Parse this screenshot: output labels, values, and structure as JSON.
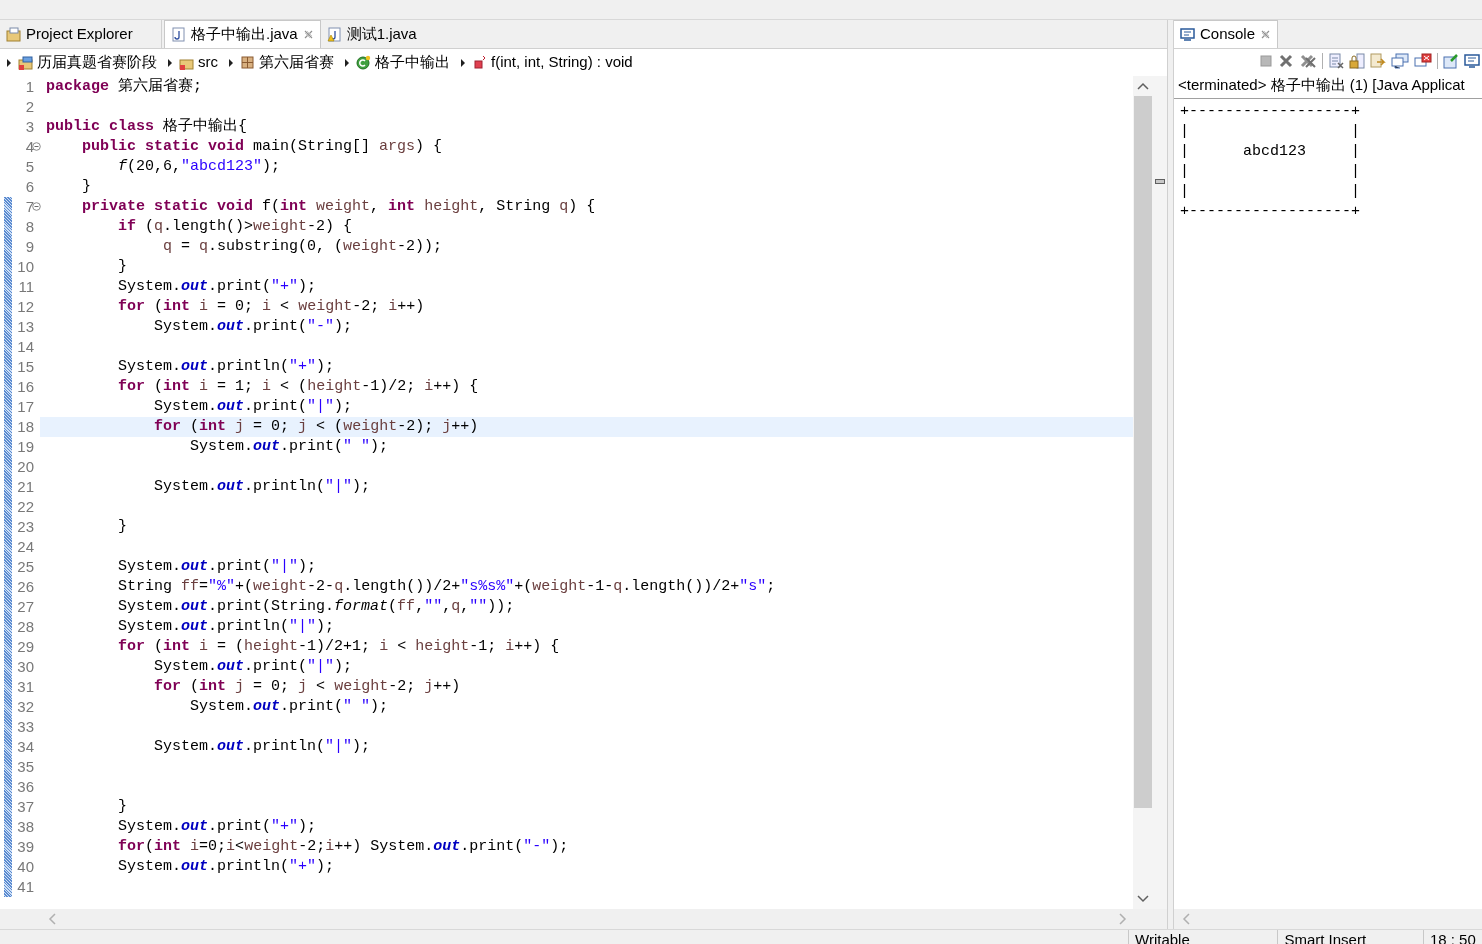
{
  "tabs": [
    {
      "label": "Project Explorer",
      "kind": "view",
      "selected": false,
      "closable": false
    },
    {
      "label": "格子中输出.java",
      "kind": "java",
      "selected": true,
      "closable": true
    },
    {
      "label": "测试1.java",
      "kind": "java-warning",
      "selected": false,
      "closable": false
    }
  ],
  "breadcrumb": [
    {
      "label": "历届真题省赛阶段",
      "kind": "project"
    },
    {
      "label": "src",
      "kind": "source"
    },
    {
      "label": "第六届省赛",
      "kind": "package"
    },
    {
      "label": "格子中输出",
      "kind": "class"
    },
    {
      "label": "f(int, int, String) : void",
      "kind": "method"
    }
  ],
  "editor": {
    "lines": [
      {
        "number": "1",
        "tokens": [
          {
            "kind": "kw",
            "text": "package"
          },
          {
            "kind": "plain",
            "text": " 第六届省赛;"
          }
        ]
      },
      {
        "number": "2"
      },
      {
        "number": "3",
        "tokens": [
          {
            "kind": "kw",
            "text": "public class"
          },
          {
            "kind": "plain",
            "text": " 格子中输出{"
          }
        ]
      },
      {
        "number": "4",
        "fold_marker": true,
        "tokens": [
          {
            "kind": "kw",
            "text": "    public static void"
          },
          {
            "kind": "plain",
            "text": " main(String[] "
          },
          {
            "kind": "var",
            "text": "args"
          },
          {
            "kind": "plain",
            "text": ") {"
          }
        ]
      },
      {
        "number": "5",
        "tokens": [
          {
            "kind": "static",
            "text": "        f"
          },
          {
            "kind": "plain",
            "text": "(20,6,"
          },
          {
            "kind": "str",
            "text": "\"abcd123\""
          },
          {
            "kind": "plain",
            "text": ");"
          }
        ]
      },
      {
        "number": "6",
        "tokens": [
          {
            "kind": "plain",
            "text": "    }"
          }
        ]
      },
      {
        "number": "7",
        "fold_marker": true,
        "changed": true,
        "tokens": [
          {
            "kind": "kw",
            "text": "    private static void"
          },
          {
            "kind": "plain",
            "text": " f("
          },
          {
            "kind": "kw",
            "text": "int "
          },
          {
            "kind": "var",
            "text": "weight"
          },
          {
            "kind": "plain",
            "text": ", "
          },
          {
            "kind": "kw",
            "text": "int "
          },
          {
            "kind": "var",
            "text": "height"
          },
          {
            "kind": "plain",
            "text": ", String "
          },
          {
            "kind": "var",
            "text": "q"
          },
          {
            "kind": "plain",
            "text": ") {"
          }
        ]
      },
      {
        "number": "8",
        "changed": true,
        "tokens": [
          {
            "kind": "kw",
            "text": "        if"
          },
          {
            "kind": "plain",
            "text": " ("
          },
          {
            "kind": "var",
            "text": "q"
          },
          {
            "kind": "plain",
            "text": ".length()>"
          },
          {
            "kind": "var",
            "text": "weight"
          },
          {
            "kind": "plain",
            "text": "-2) {"
          }
        ]
      },
      {
        "number": "9",
        "changed": true,
        "tokens": [
          {
            "kind": "var",
            "text": "             q"
          },
          {
            "kind": "plain",
            "text": " = "
          },
          {
            "kind": "var",
            "text": "q"
          },
          {
            "kind": "plain",
            "text": ".substring(0, ("
          },
          {
            "kind": "var",
            "text": "weight"
          },
          {
            "kind": "plain",
            "text": "-2));"
          }
        ]
      },
      {
        "number": "10",
        "changed": true,
        "tokens": [
          {
            "kind": "plain",
            "text": "        }"
          }
        ]
      },
      {
        "number": "11",
        "changed": true,
        "tokens": [
          {
            "kind": "plain",
            "text": "        System."
          },
          {
            "kind": "field",
            "text": "out"
          },
          {
            "kind": "plain",
            "text": ".print("
          },
          {
            "kind": "str",
            "text": "\"+\""
          },
          {
            "kind": "plain",
            "text": ");"
          }
        ]
      },
      {
        "number": "12",
        "changed": true,
        "tokens": [
          {
            "kind": "kw",
            "text": "        for"
          },
          {
            "kind": "plain",
            "text": " ("
          },
          {
            "kind": "kw",
            "text": "int "
          },
          {
            "kind": "var",
            "text": "i"
          },
          {
            "kind": "plain",
            "text": " = 0; "
          },
          {
            "kind": "var",
            "text": "i"
          },
          {
            "kind": "plain",
            "text": " < "
          },
          {
            "kind": "var",
            "text": "weight"
          },
          {
            "kind": "plain",
            "text": "-2; "
          },
          {
            "kind": "var",
            "text": "i"
          },
          {
            "kind": "plain",
            "text": "++)"
          }
        ]
      },
      {
        "number": "13",
        "changed": true,
        "tokens": [
          {
            "kind": "plain",
            "text": "            System."
          },
          {
            "kind": "field",
            "text": "out"
          },
          {
            "kind": "plain",
            "text": ".print("
          },
          {
            "kind": "str",
            "text": "\"-\""
          },
          {
            "kind": "plain",
            "text": ");"
          }
        ]
      },
      {
        "number": "14",
        "changed": true
      },
      {
        "number": "15",
        "changed": true,
        "tokens": [
          {
            "kind": "plain",
            "text": "        System."
          },
          {
            "kind": "field",
            "text": "out"
          },
          {
            "kind": "plain",
            "text": ".println("
          },
          {
            "kind": "str",
            "text": "\"+\""
          },
          {
            "kind": "plain",
            "text": ");"
          }
        ]
      },
      {
        "number": "16",
        "changed": true,
        "tokens": [
          {
            "kind": "kw",
            "text": "        for"
          },
          {
            "kind": "plain",
            "text": " ("
          },
          {
            "kind": "kw",
            "text": "int "
          },
          {
            "kind": "var",
            "text": "i"
          },
          {
            "kind": "plain",
            "text": " = 1; "
          },
          {
            "kind": "var",
            "text": "i"
          },
          {
            "kind": "plain",
            "text": " < ("
          },
          {
            "kind": "var",
            "text": "height"
          },
          {
            "kind": "plain",
            "text": "-1)/2; "
          },
          {
            "kind": "var",
            "text": "i"
          },
          {
            "kind": "plain",
            "text": "++) {"
          }
        ]
      },
      {
        "number": "17",
        "changed": true,
        "tokens": [
          {
            "kind": "plain",
            "text": "            System."
          },
          {
            "kind": "field",
            "text": "out"
          },
          {
            "kind": "plain",
            "text": ".print("
          },
          {
            "kind": "str",
            "text": "\"|\""
          },
          {
            "kind": "plain",
            "text": ");"
          }
        ]
      },
      {
        "number": "18",
        "changed": true,
        "current": true,
        "tokens": [
          {
            "kind": "kw",
            "text": "            for"
          },
          {
            "kind": "plain",
            "text": " ("
          },
          {
            "kind": "kw",
            "text": "int "
          },
          {
            "kind": "var",
            "text": "j"
          },
          {
            "kind": "plain",
            "text": " = 0; "
          },
          {
            "kind": "var",
            "text": "j"
          },
          {
            "kind": "plain",
            "text": " < ("
          },
          {
            "kind": "var",
            "text": "weight"
          },
          {
            "kind": "plain",
            "text": "-2); "
          },
          {
            "kind": "var",
            "text": "j"
          },
          {
            "kind": "plain",
            "text": "++)"
          }
        ]
      },
      {
        "number": "19",
        "changed": true,
        "tokens": [
          {
            "kind": "plain",
            "text": "                System."
          },
          {
            "kind": "field",
            "text": "out"
          },
          {
            "kind": "plain",
            "text": ".print("
          },
          {
            "kind": "str",
            "text": "\" \""
          },
          {
            "kind": "plain",
            "text": ");"
          }
        ]
      },
      {
        "number": "20",
        "changed": true
      },
      {
        "number": "21",
        "changed": true,
        "tokens": [
          {
            "kind": "plain",
            "text": "            System."
          },
          {
            "kind": "field",
            "text": "out"
          },
          {
            "kind": "plain",
            "text": ".println("
          },
          {
            "kind": "str",
            "text": "\"|\""
          },
          {
            "kind": "plain",
            "text": ");"
          }
        ]
      },
      {
        "number": "22",
        "changed": true
      },
      {
        "number": "23",
        "changed": true,
        "tokens": [
          {
            "kind": "plain",
            "text": "        }"
          }
        ]
      },
      {
        "number": "24",
        "changed": true
      },
      {
        "number": "25",
        "changed": true,
        "tokens": [
          {
            "kind": "plain",
            "text": "        System."
          },
          {
            "kind": "field",
            "text": "out"
          },
          {
            "kind": "plain",
            "text": ".print("
          },
          {
            "kind": "str",
            "text": "\"|\""
          },
          {
            "kind": "plain",
            "text": ");"
          }
        ]
      },
      {
        "number": "26",
        "changed": true,
        "tokens": [
          {
            "kind": "plain",
            "text": "        String "
          },
          {
            "kind": "var",
            "text": "ff"
          },
          {
            "kind": "plain",
            "text": "="
          },
          {
            "kind": "str",
            "text": "\"%\""
          },
          {
            "kind": "plain",
            "text": "+("
          },
          {
            "kind": "var",
            "text": "weight"
          },
          {
            "kind": "plain",
            "text": "-2-"
          },
          {
            "kind": "var",
            "text": "q"
          },
          {
            "kind": "plain",
            "text": ".length())/2+"
          },
          {
            "kind": "str",
            "text": "\"s%s%\""
          },
          {
            "kind": "plain",
            "text": "+("
          },
          {
            "kind": "var",
            "text": "weight"
          },
          {
            "kind": "plain",
            "text": "-1-"
          },
          {
            "kind": "var",
            "text": "q"
          },
          {
            "kind": "plain",
            "text": ".length())/2+"
          },
          {
            "kind": "str",
            "text": "\"s\""
          },
          {
            "kind": "plain",
            "text": ";"
          }
        ]
      },
      {
        "number": "27",
        "changed": true,
        "tokens": [
          {
            "kind": "plain",
            "text": "        System."
          },
          {
            "kind": "field",
            "text": "out"
          },
          {
            "kind": "plain",
            "text": ".print(String."
          },
          {
            "kind": "static",
            "text": "format"
          },
          {
            "kind": "plain",
            "text": "("
          },
          {
            "kind": "var",
            "text": "ff"
          },
          {
            "kind": "plain",
            "text": ","
          },
          {
            "kind": "str",
            "text": "\"\""
          },
          {
            "kind": "plain",
            "text": ","
          },
          {
            "kind": "var",
            "text": "q"
          },
          {
            "kind": "plain",
            "text": ","
          },
          {
            "kind": "str",
            "text": "\"\""
          },
          {
            "kind": "plain",
            "text": "));"
          }
        ]
      },
      {
        "number": "28",
        "changed": true,
        "tokens": [
          {
            "kind": "plain",
            "text": "        System."
          },
          {
            "kind": "field",
            "text": "out"
          },
          {
            "kind": "plain",
            "text": ".println("
          },
          {
            "kind": "str",
            "text": "\"|\""
          },
          {
            "kind": "plain",
            "text": ");"
          }
        ]
      },
      {
        "number": "29",
        "changed": true,
        "tokens": [
          {
            "kind": "kw",
            "text": "        for"
          },
          {
            "kind": "plain",
            "text": " ("
          },
          {
            "kind": "kw",
            "text": "int "
          },
          {
            "kind": "var",
            "text": "i"
          },
          {
            "kind": "plain",
            "text": " = ("
          },
          {
            "kind": "var",
            "text": "height"
          },
          {
            "kind": "plain",
            "text": "-1)/2+1; "
          },
          {
            "kind": "var",
            "text": "i"
          },
          {
            "kind": "plain",
            "text": " < "
          },
          {
            "kind": "var",
            "text": "height"
          },
          {
            "kind": "plain",
            "text": "-1; "
          },
          {
            "kind": "var",
            "text": "i"
          },
          {
            "kind": "plain",
            "text": "++) {"
          }
        ]
      },
      {
        "number": "30",
        "changed": true,
        "tokens": [
          {
            "kind": "plain",
            "text": "            System."
          },
          {
            "kind": "field",
            "text": "out"
          },
          {
            "kind": "plain",
            "text": ".print("
          },
          {
            "kind": "str",
            "text": "\"|\""
          },
          {
            "kind": "plain",
            "text": ");"
          }
        ]
      },
      {
        "number": "31",
        "changed": true,
        "tokens": [
          {
            "kind": "kw",
            "text": "            for"
          },
          {
            "kind": "plain",
            "text": " ("
          },
          {
            "kind": "kw",
            "text": "int "
          },
          {
            "kind": "var",
            "text": "j"
          },
          {
            "kind": "plain",
            "text": " = 0; "
          },
          {
            "kind": "var",
            "text": "j"
          },
          {
            "kind": "plain",
            "text": " < "
          },
          {
            "kind": "var",
            "text": "weight"
          },
          {
            "kind": "plain",
            "text": "-2; "
          },
          {
            "kind": "var",
            "text": "j"
          },
          {
            "kind": "plain",
            "text": "++)"
          }
        ]
      },
      {
        "number": "32",
        "changed": true,
        "tokens": [
          {
            "kind": "plain",
            "text": "                System."
          },
          {
            "kind": "field",
            "text": "out"
          },
          {
            "kind": "plain",
            "text": ".print("
          },
          {
            "kind": "str",
            "text": "\" \""
          },
          {
            "kind": "plain",
            "text": ");"
          }
        ]
      },
      {
        "number": "33",
        "changed": true
      },
      {
        "number": "34",
        "changed": true,
        "tokens": [
          {
            "kind": "plain",
            "text": "            System."
          },
          {
            "kind": "field",
            "text": "out"
          },
          {
            "kind": "plain",
            "text": ".println("
          },
          {
            "kind": "str",
            "text": "\"|\""
          },
          {
            "kind": "plain",
            "text": ");"
          }
        ]
      },
      {
        "number": "35",
        "changed": true
      },
      {
        "number": "36",
        "changed": true
      },
      {
        "number": "37",
        "changed": true,
        "tokens": [
          {
            "kind": "plain",
            "text": "        }"
          }
        ]
      },
      {
        "number": "38",
        "changed": true,
        "tokens": [
          {
            "kind": "plain",
            "text": "        System."
          },
          {
            "kind": "field",
            "text": "out"
          },
          {
            "kind": "plain",
            "text": ".print("
          },
          {
            "kind": "str",
            "text": "\"+\""
          },
          {
            "kind": "plain",
            "text": ");"
          }
        ]
      },
      {
        "number": "39",
        "changed": true,
        "tokens": [
          {
            "kind": "kw",
            "text": "        for"
          },
          {
            "kind": "plain",
            "text": "("
          },
          {
            "kind": "kw",
            "text": "int "
          },
          {
            "kind": "var",
            "text": "i"
          },
          {
            "kind": "plain",
            "text": "=0;"
          },
          {
            "kind": "var",
            "text": "i"
          },
          {
            "kind": "plain",
            "text": "<"
          },
          {
            "kind": "var",
            "text": "weight"
          },
          {
            "kind": "plain",
            "text": "-2;"
          },
          {
            "kind": "var",
            "text": "i"
          },
          {
            "kind": "plain",
            "text": "++) System."
          },
          {
            "kind": "field",
            "text": "out"
          },
          {
            "kind": "plain",
            "text": ".print("
          },
          {
            "kind": "str",
            "text": "\"-\""
          },
          {
            "kind": "plain",
            "text": ");"
          }
        ]
      },
      {
        "number": "40",
        "changed": true,
        "tokens": [
          {
            "kind": "plain",
            "text": "        System."
          },
          {
            "kind": "field",
            "text": "out"
          },
          {
            "kind": "plain",
            "text": ".println("
          },
          {
            "kind": "str",
            "text": "\"+\""
          },
          {
            "kind": "plain",
            "text": ");"
          }
        ]
      },
      {
        "number": "41",
        "changed": true
      }
    ]
  },
  "console": {
    "tab": {
      "label": "Console",
      "closable": true
    },
    "header": "<terminated> 格子中输出 (1) [Java Applicat",
    "output": [
      "+------------------+",
      "|                  |",
      "|      abcd123     |",
      "|                  |",
      "|                  |",
      "+------------------+"
    ]
  },
  "status_bar": [
    "Writable",
    "Smart Insert",
    "18 : 50"
  ]
}
